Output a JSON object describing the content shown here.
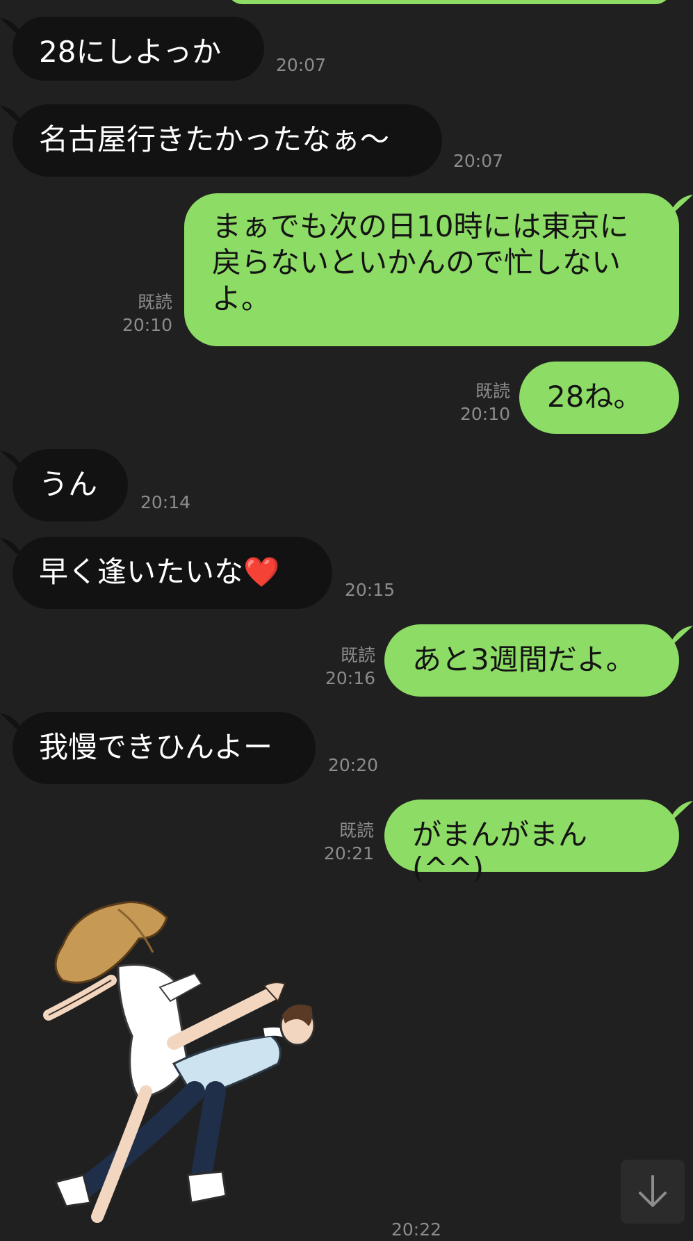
{
  "colors": {
    "background": "#202020",
    "incoming_bubble": "#121212",
    "outgoing_bubble": "#8ddc65",
    "meta_text": "#8c8c8c"
  },
  "messages": [
    {
      "side": "in",
      "text": "28にしよっか",
      "time": "20:07"
    },
    {
      "side": "in",
      "text": "名古屋行きたかったなぁ〜",
      "time": "20:07"
    },
    {
      "side": "out",
      "text": "まぁでも次の日10時には東京に\n戻らないといかんので忙しない\nよ。",
      "read": "既読",
      "time": "20:10"
    },
    {
      "side": "out",
      "text": "28ね。",
      "read": "既読",
      "time": "20:10"
    },
    {
      "side": "in",
      "text": "うん",
      "time": "20:14"
    },
    {
      "side": "in",
      "text": "早く逢いたいな❤️",
      "time": "20:15"
    },
    {
      "side": "out",
      "text": "あと3週間だよ。",
      "read": "既読",
      "time": "20:16"
    },
    {
      "side": "in",
      "text": "我慢できひんよー",
      "time": "20:20"
    },
    {
      "side": "out",
      "text": "がまんがまん(^^)",
      "read": "既読",
      "time": "20:21"
    }
  ],
  "sticker": {
    "icon": "couple-running-sticker"
  },
  "partial_time": "20:22",
  "scroll_button": {
    "icon": "arrow-down-icon"
  }
}
